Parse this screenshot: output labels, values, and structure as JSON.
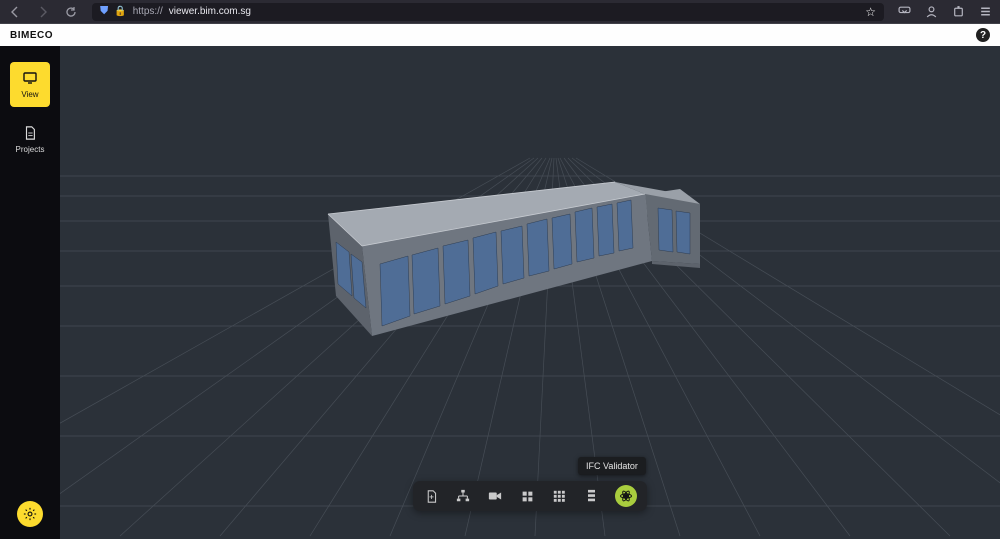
{
  "browser": {
    "shield_icon": "shield",
    "lock_icon": "lock",
    "url_prefix": "https://",
    "url_host": "viewer.bim.com.sg",
    "url_path": ""
  },
  "header": {
    "brand": "BIMECO",
    "help_icon": "?"
  },
  "sidebar": {
    "items": [
      {
        "label": "View",
        "icon": "display",
        "active": true
      },
      {
        "label": "Projects",
        "icon": "file",
        "active": false
      }
    ],
    "fab_icon": "gear"
  },
  "toolbar": {
    "buttons": [
      {
        "name": "file",
        "icon": "file"
      },
      {
        "name": "tree",
        "icon": "sitemap"
      },
      {
        "name": "camera",
        "icon": "video"
      },
      {
        "name": "grid4",
        "icon": "grid4"
      },
      {
        "name": "grid9",
        "icon": "grid9"
      },
      {
        "name": "rows",
        "icon": "rows"
      },
      {
        "name": "validator",
        "icon": "atom",
        "highlight": true
      }
    ],
    "tooltip": "IFC Validator"
  },
  "model": {
    "description": "Low L-shaped commercial building, single storey, grey walls, blue glazed curtain-wall windows along south and east facades, flat light-grey roof.",
    "wall_color": "#6f7680",
    "window_color": "#4f6d96",
    "roof_color": "#9aa0a8",
    "grid_color": "#5a6068",
    "bg_color": "#2b3139"
  }
}
